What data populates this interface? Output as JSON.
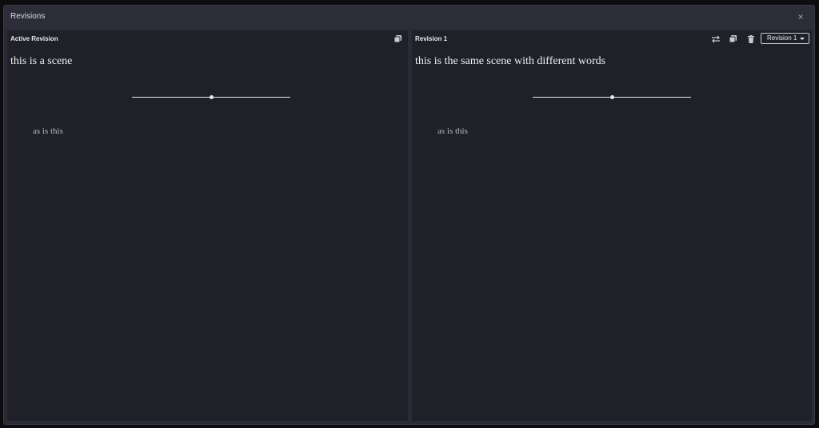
{
  "window": {
    "title": "Revisions",
    "close_label": "×"
  },
  "panels": {
    "active": {
      "label": "Active Revision",
      "heading": "this is a scene",
      "body": "as is this",
      "icons": [
        "copy-icon"
      ]
    },
    "compare": {
      "label": "Revision 1",
      "heading": "this is the same scene with different words",
      "body": "as is this",
      "icons": [
        "swap-icon",
        "copy-icon",
        "trash-icon"
      ],
      "selector": {
        "selected": "Revision 1"
      }
    }
  },
  "colors": {
    "background": "#0d0d10",
    "window": "#2a2b36",
    "panel": "#202029",
    "text": "#eceef3",
    "muted_text": "#b5b6c0"
  }
}
